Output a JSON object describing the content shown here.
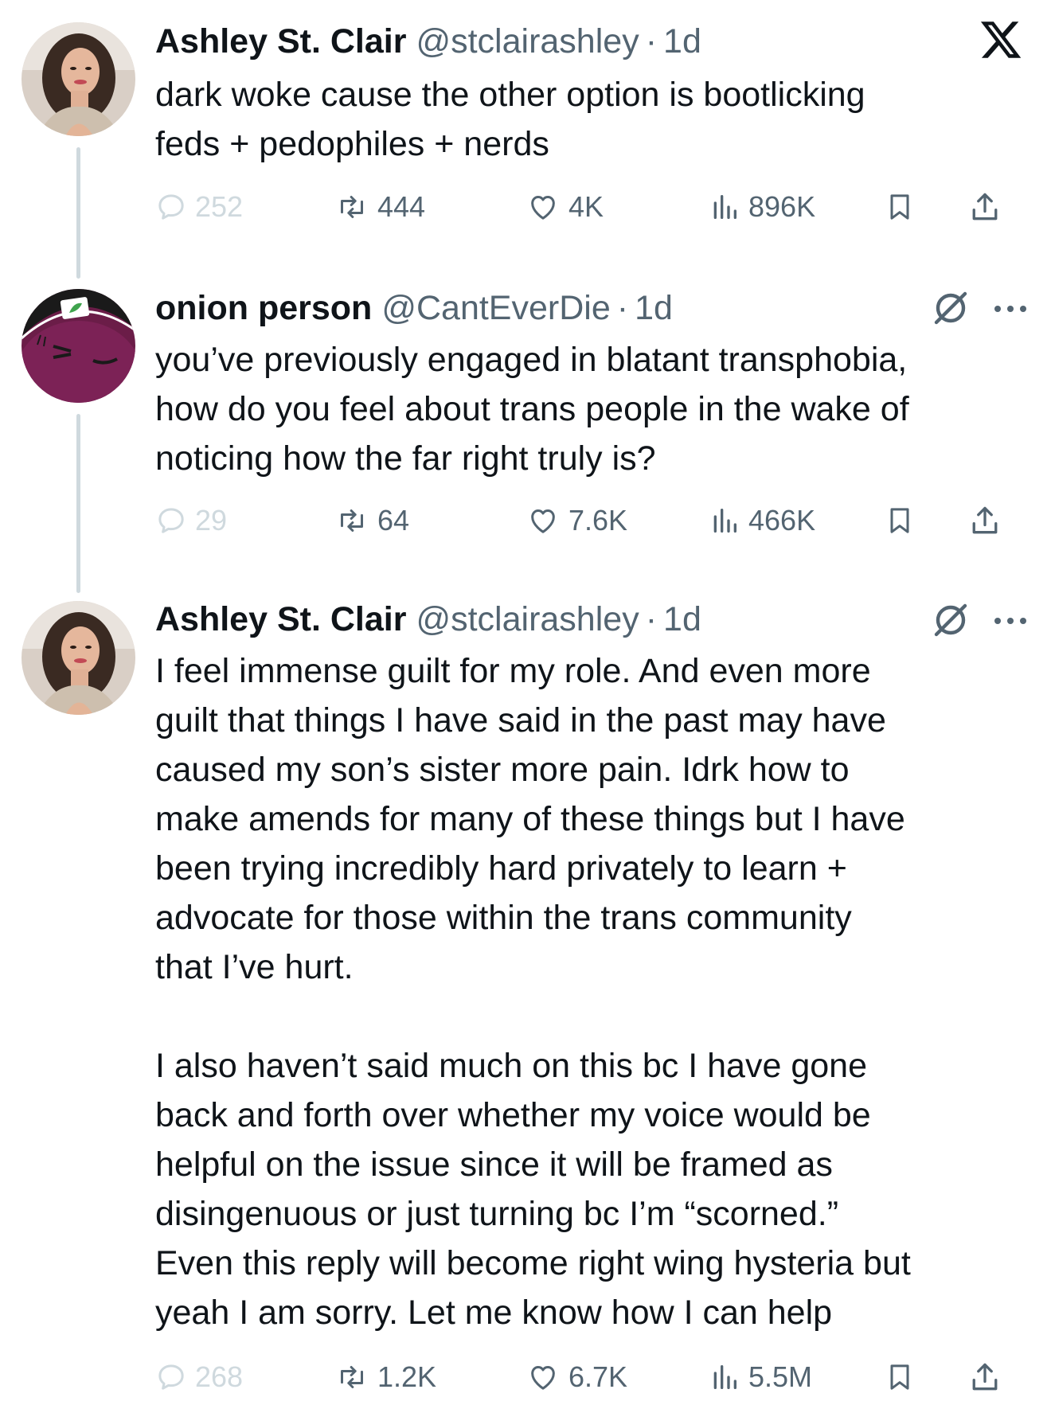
{
  "app": {
    "logo_icon": "x-logo-icon"
  },
  "tweets": [
    {
      "name": "Ashley St. Clair",
      "handle": "@stclairashley",
      "separator": "·",
      "time": "1d",
      "text": "dark woke cause the other option is bootlicking\nfeds + pedophiles + nerds",
      "stats": {
        "replies": "252",
        "reposts": "444",
        "likes": "4K",
        "views": "896K"
      }
    },
    {
      "name": "onion person",
      "handle": "@CantEverDie",
      "separator": "·",
      "time": "1d",
      "text": "you’ve previously engaged in blatant transphobia,\nhow do you feel about trans people in the wake of\nnoticing how the far right truly is?",
      "stats": {
        "replies": "29",
        "reposts": "64",
        "likes": "7.6K",
        "views": "466K"
      }
    },
    {
      "name": "Ashley St. Clair",
      "handle": "@stclairashley",
      "separator": "·",
      "time": "1d",
      "text": "I feel immense guilt for my role. And even more\nguilt that things I have said in the past may have\ncaused my son’s sister more pain. Idrk how to\nmake amends for many of these things but I have\nbeen trying incredibly hard privately to learn +\nadvocate for those within the trans community\nthat I’ve hurt.\n\nI also haven’t said much on this bc I have gone\nback and forth over whether my voice would be\nhelpful on the issue since it will be framed as\ndisingenuous or just turning bc I’m “scorned.”\nEven this reply will become right wing hysteria but\nyeah I am sorry. Let me know how I can help",
      "stats": {
        "replies": "268",
        "reposts": "1.2K",
        "likes": "6.7K",
        "views": "5.5M"
      }
    }
  ],
  "colors": {
    "text": "#0f1419",
    "secondary": "#536471",
    "faded": "#cfd9de",
    "thread_line": "#cfd9de"
  }
}
